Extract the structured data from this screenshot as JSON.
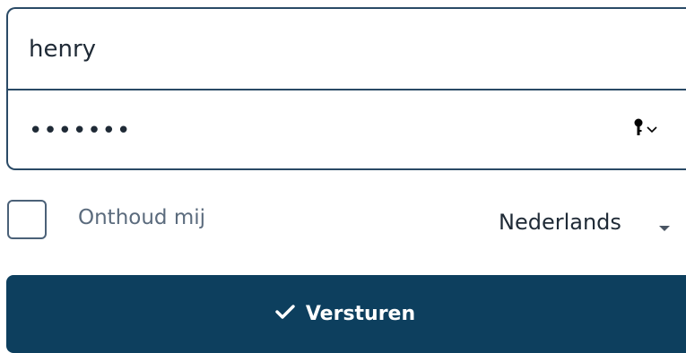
{
  "login_form": {
    "username_value": "henry",
    "password_value": "•••••••",
    "remember_label": "Onthoud mij",
    "language_selected": "Nederlands",
    "submit_label": "Versturen"
  },
  "icons": {
    "password_manager": "key-icon",
    "password_manager_caret": "chevron-down-icon",
    "language_caret": "caret-down-icon",
    "submit": "check-icon"
  },
  "colors": {
    "border": "#2a4a66",
    "button_bg": "#0d3f5e",
    "button_text": "#ffffff",
    "label_text": "#5b6b7d"
  }
}
